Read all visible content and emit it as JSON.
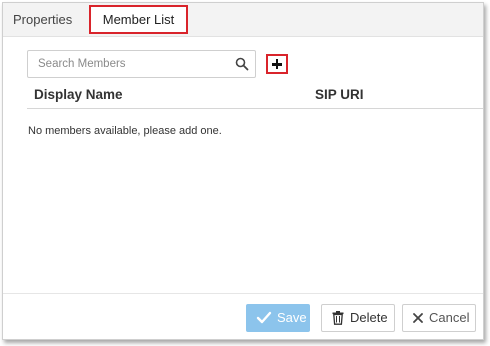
{
  "tabs": [
    {
      "label": "Properties"
    },
    {
      "label": "Member List"
    }
  ],
  "search": {
    "placeholder": "Search Members",
    "value": ""
  },
  "table": {
    "columns": [
      "Display Name",
      "SIP URI"
    ],
    "empty_message": "No members available, please add one."
  },
  "footer": {
    "save_label": "Save",
    "delete_label": "Delete",
    "cancel_label": "Cancel"
  },
  "icons": {
    "search": "search-icon",
    "add": "plus-icon",
    "save": "check-icon",
    "delete": "trash-icon",
    "cancel": "close-icon"
  },
  "colors": {
    "highlight": "#d9242b",
    "save_button": "#8cc4ec"
  }
}
